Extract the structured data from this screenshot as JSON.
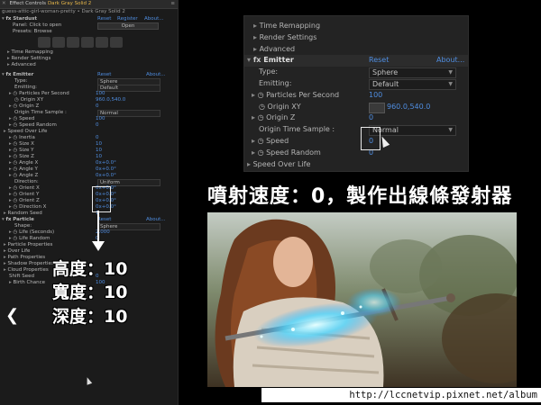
{
  "panel": {
    "tab_label": "Effect Controls",
    "tab_layer": "Dark Gray Solid 2",
    "comp_line": "guess-attic-girl-woman-pretty • Dark Gray Solid 2",
    "effect_name": "Stardust",
    "effect_links": {
      "reset": "Reset",
      "register": "Register",
      "about": "About..."
    },
    "panel_label": "Panel: Click to open",
    "open_button": "Open",
    "presets_label": "Presets: Browse",
    "rows": [
      {
        "label": "Time Remapping"
      },
      {
        "label": "Render Settings"
      },
      {
        "label": "Advanced"
      }
    ],
    "emitter": {
      "name": "Emitter",
      "reset": "Reset",
      "about": "About...",
      "type_label": "Type:",
      "type_value": "Sphere",
      "emitting_label": "Emitting:",
      "emitting_value": "Default",
      "pps_label": "Particles Per Second",
      "pps_value": "100",
      "origin_xy_label": "Origin XY",
      "origin_xy_value": "960.0,540.0",
      "origin_z_label": "Origin Z",
      "origin_z_value": "0",
      "ots_label": "Origin Time Sample :",
      "ots_value": "Normal",
      "speed_label": "Speed",
      "speed_value": "100",
      "speed_random_label": "Speed Random",
      "speed_random_value": "0",
      "speed_over_life": "Speed Over Life",
      "inertia_label": "Inertia",
      "inertia_value": "0",
      "size_x_label": "Size X",
      "size_x_value": "10",
      "size_y_label": "Size Y",
      "size_y_value": "10",
      "size_z_label": "Size Z",
      "size_z_value": "10",
      "angle_x_label": "Angle X",
      "angle_x_value": "0x+0.0°",
      "angle_y_label": "Angle Y",
      "angle_y_value": "0x+0.0°",
      "angle_z_label": "Angle Z",
      "angle_z_value": "0x+0.0°",
      "direction_label": "Direction:",
      "direction_value": "Uniform",
      "orient_x_label": "Orient X",
      "orient_x_value": "0x+0.0°",
      "orient_y_label": "Orient Y",
      "orient_y_value": "0x+0.0°",
      "orient_z_label": "Orient Z",
      "orient_z_value": "0x+0.0°",
      "direction_x_label": "Direction X",
      "direction_x_value": "0x+0.0°",
      "random_seed": "Random Seed",
      "random_seed_value": "1"
    },
    "particle": {
      "name": "Particle",
      "reset": "Reset",
      "about": "About...",
      "shape_label": "Shape:",
      "shape_value": "Sphere",
      "life_label": "Life (Seconds)",
      "life_value": "2.000",
      "life_random_label": "Life Random",
      "life_random_value": "0",
      "particle_props": "Particle Properties",
      "over_life": "Over Life",
      "path_props": "Path Properties",
      "shadow_props": "Shadow Properties",
      "cloud_props": "Cloud Properties",
      "shift_seed_label": "Shift Seed",
      "shift_seed_value": "0",
      "birth_chance_label": "Birth Chance",
      "birth_chance_value": "100"
    }
  },
  "callout": {
    "line1": "高度：10",
    "line2": "寬度：10",
    "line3": "深度：10",
    "nav_arrow": "❮"
  },
  "zoom": {
    "time_remapping": "Time Remapping",
    "render_settings": "Render Settings",
    "advanced": "Advanced",
    "emitter": "Emitter",
    "reset": "Reset",
    "about": "About...",
    "type_label": "Type:",
    "type_value": "Sphere",
    "emitting_label": "Emitting:",
    "emitting_value": "Default",
    "pps_label": "Particles Per Second",
    "pps_value": "100",
    "origin_xy_label": "Origin XY",
    "origin_xy_value": "960.0,540.0",
    "origin_z_label": "Origin Z",
    "origin_z_value": "0",
    "ots_label": "Origin Time Sample :",
    "ots_value": "Normal",
    "speed_label": "Speed",
    "speed_value": "0",
    "speed_random_label": "Speed Random",
    "speed_random_value": "0",
    "speed_over_life": "Speed Over Life"
  },
  "caption": "噴射速度：0，製作出線條發射器",
  "url": "http://lccnetvip.pixnet.net/album",
  "colors": {
    "value_blue": "#4f8de0",
    "highlight": "#e8b84a"
  }
}
